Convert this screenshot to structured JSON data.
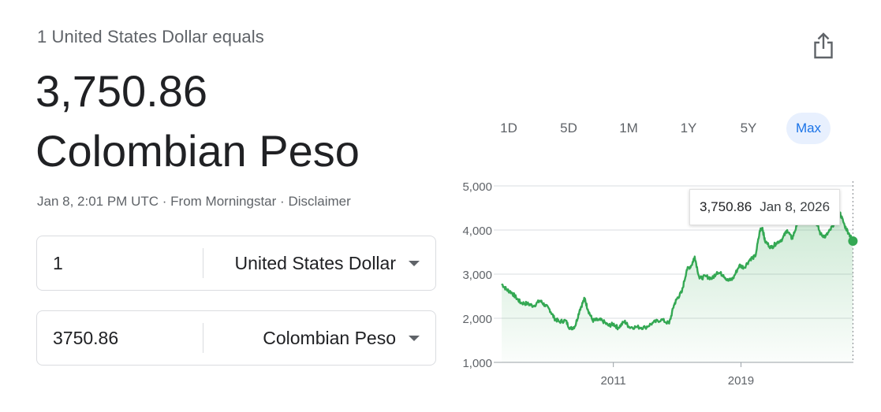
{
  "header": {
    "title": "1 United States Dollar equals",
    "amount": "3,750.86",
    "currency_name": "Colombian Peso"
  },
  "meta": {
    "timestamp": "Jan 8, 2:01 PM UTC",
    "separator": "·",
    "source": "From Morningstar",
    "disclaimer": "Disclaimer"
  },
  "converter": {
    "from": {
      "value": "1",
      "currency": "United States Dollar"
    },
    "to": {
      "value": "3750.86",
      "currency": "Colombian Peso"
    }
  },
  "range_tabs": [
    {
      "label": "1D",
      "active": false
    },
    {
      "label": "5D",
      "active": false
    },
    {
      "label": "1M",
      "active": false
    },
    {
      "label": "1Y",
      "active": false
    },
    {
      "label": "5Y",
      "active": false
    },
    {
      "label": "Max",
      "active": true
    }
  ],
  "tooltip": {
    "value": "3,750.86",
    "date": "Jan 8, 2026"
  },
  "icons": {
    "share": "share-icon",
    "dropdown": "caret-down-icon"
  },
  "colors": {
    "line": "#34a853",
    "fill_top": "#34a853",
    "accent": "#1a73e8",
    "active_tab_bg": "#e8f0fe"
  },
  "chart_data": {
    "type": "line",
    "title": "",
    "xlabel": "",
    "ylabel": "",
    "x_tick_labels": [
      "2011",
      "2019"
    ],
    "y_tick_labels": [
      "5,000",
      "4,000",
      "3,000",
      "2,000",
      "1,000"
    ],
    "y_ticks": [
      5000,
      4000,
      3000,
      2000,
      1000
    ],
    "ylim": [
      1000,
      5000
    ],
    "xlim": [
      2003.5,
      2026.05
    ],
    "x_ticks": [
      2011,
      2019
    ],
    "grid": "horizontal",
    "series": [
      {
        "values": [
          [
            2004.0,
            2780
          ],
          [
            2004.3,
            2650
          ],
          [
            2004.6,
            2590
          ],
          [
            2004.9,
            2470
          ],
          [
            2005.2,
            2350
          ],
          [
            2005.6,
            2330
          ],
          [
            2006.0,
            2280
          ],
          [
            2006.4,
            2400
          ],
          [
            2006.7,
            2300
          ],
          [
            2007.0,
            2200
          ],
          [
            2007.3,
            2000
          ],
          [
            2007.6,
            1920
          ],
          [
            2008.0,
            1950
          ],
          [
            2008.3,
            1760
          ],
          [
            2008.6,
            1820
          ],
          [
            2008.9,
            2200
          ],
          [
            2009.2,
            2450
          ],
          [
            2009.4,
            2200
          ],
          [
            2009.7,
            1950
          ],
          [
            2010.0,
            1960
          ],
          [
            2010.3,
            1950
          ],
          [
            2010.7,
            1830
          ],
          [
            2011.0,
            1870
          ],
          [
            2011.3,
            1780
          ],
          [
            2011.7,
            1930
          ],
          [
            2012.0,
            1800
          ],
          [
            2012.5,
            1800
          ],
          [
            2013.0,
            1790
          ],
          [
            2013.5,
            1900
          ],
          [
            2014.0,
            1970
          ],
          [
            2014.5,
            1880
          ],
          [
            2014.8,
            2300
          ],
          [
            2015.0,
            2450
          ],
          [
            2015.3,
            2600
          ],
          [
            2015.6,
            3100
          ],
          [
            2015.9,
            3200
          ],
          [
            2016.1,
            3400
          ],
          [
            2016.4,
            2900
          ],
          [
            2016.8,
            2950
          ],
          [
            2017.2,
            2900
          ],
          [
            2017.5,
            3050
          ],
          [
            2017.9,
            2980
          ],
          [
            2018.2,
            2850
          ],
          [
            2018.5,
            2900
          ],
          [
            2018.9,
            3200
          ],
          [
            2019.2,
            3150
          ],
          [
            2019.6,
            3350
          ],
          [
            2019.9,
            3400
          ],
          [
            2020.2,
            4000
          ],
          [
            2020.35,
            4050
          ],
          [
            2020.5,
            3750
          ],
          [
            2020.9,
            3600
          ],
          [
            2021.2,
            3700
          ],
          [
            2021.6,
            3800
          ],
          [
            2021.9,
            4000
          ],
          [
            2022.2,
            3800
          ],
          [
            2022.5,
            4100
          ],
          [
            2022.8,
            4900
          ],
          [
            2022.95,
            4700
          ],
          [
            2023.1,
            4600
          ],
          [
            2023.4,
            4300
          ],
          [
            2023.7,
            4200
          ],
          [
            2024.0,
            3900
          ],
          [
            2024.3,
            3850
          ],
          [
            2024.6,
            4000
          ],
          [
            2024.9,
            4200
          ],
          [
            2025.2,
            4400
          ],
          [
            2025.5,
            4100
          ],
          [
            2025.8,
            3900
          ],
          [
            2026.02,
            3750.86
          ]
        ]
      }
    ]
  }
}
